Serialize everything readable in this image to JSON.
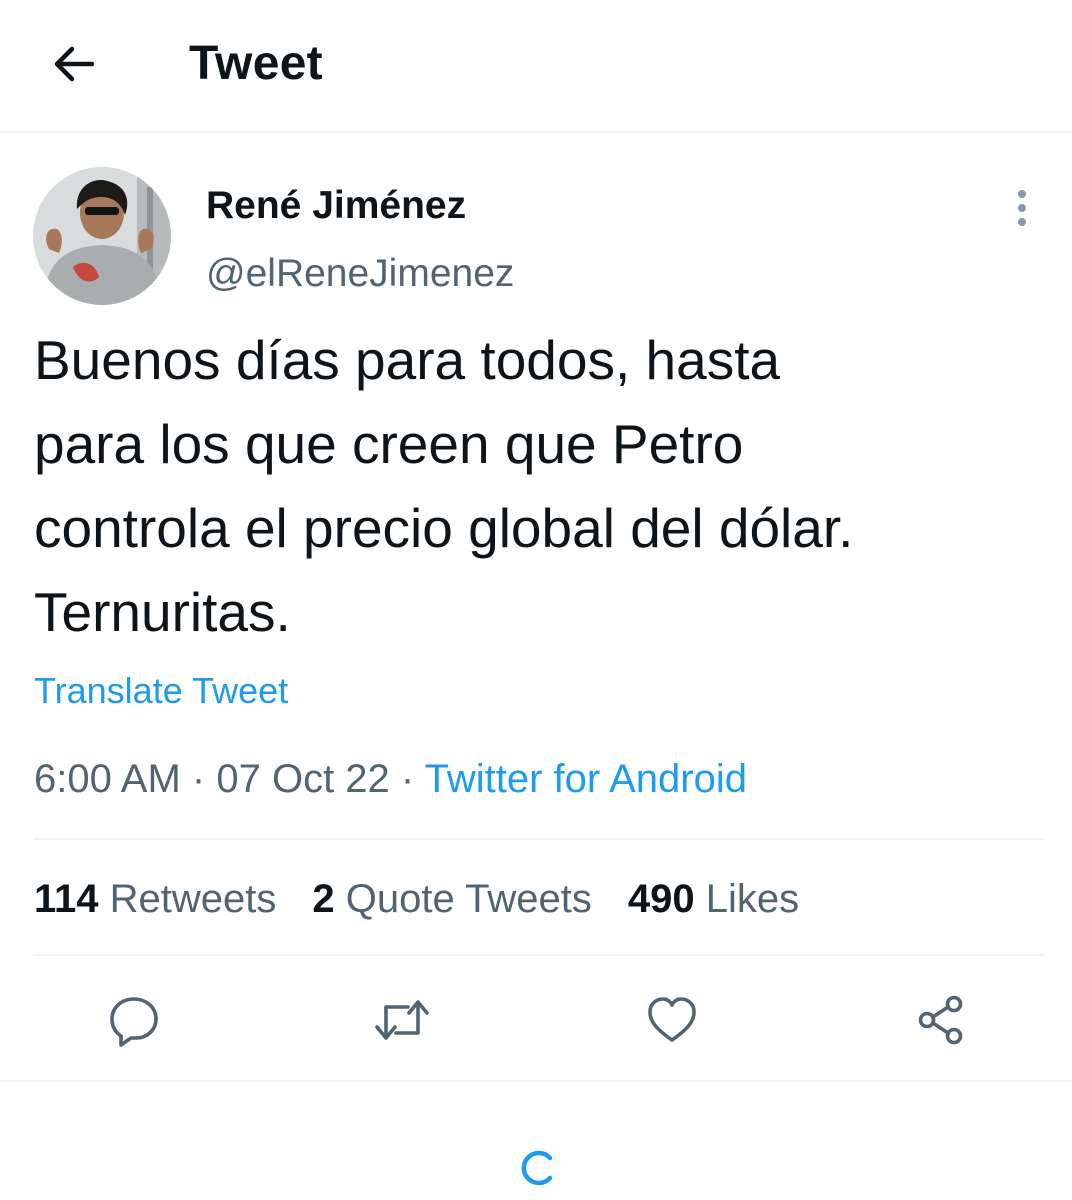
{
  "header": {
    "title": "Tweet",
    "back_icon": "arrow-left-icon"
  },
  "author": {
    "display_name": "René Jiménez",
    "handle": "@elReneJimenez",
    "avatar_icon": "avatar-photo"
  },
  "tweet": {
    "text": "Buenos días para todos, hasta\npara los que creen que Petro\ncontrola el precio global del dólar.\nTernuritas.",
    "translate_label": "Translate Tweet",
    "time": "6:00 AM",
    "separator": "·",
    "date": "07 Oct 22",
    "source": "Twitter for Android"
  },
  "stats": {
    "retweets_count": "114",
    "retweets_label": "Retweets",
    "quotes_count": "2",
    "quotes_label": "Quote Tweets",
    "likes_count": "490",
    "likes_label": "Likes"
  },
  "actions": [
    "reply-icon",
    "retweet-icon",
    "like-icon",
    "share-icon"
  ],
  "colors": {
    "accent": "#1d9bf0",
    "text_primary": "#0f1419",
    "text_secondary": "#536471",
    "divider": "#eff3f4"
  }
}
